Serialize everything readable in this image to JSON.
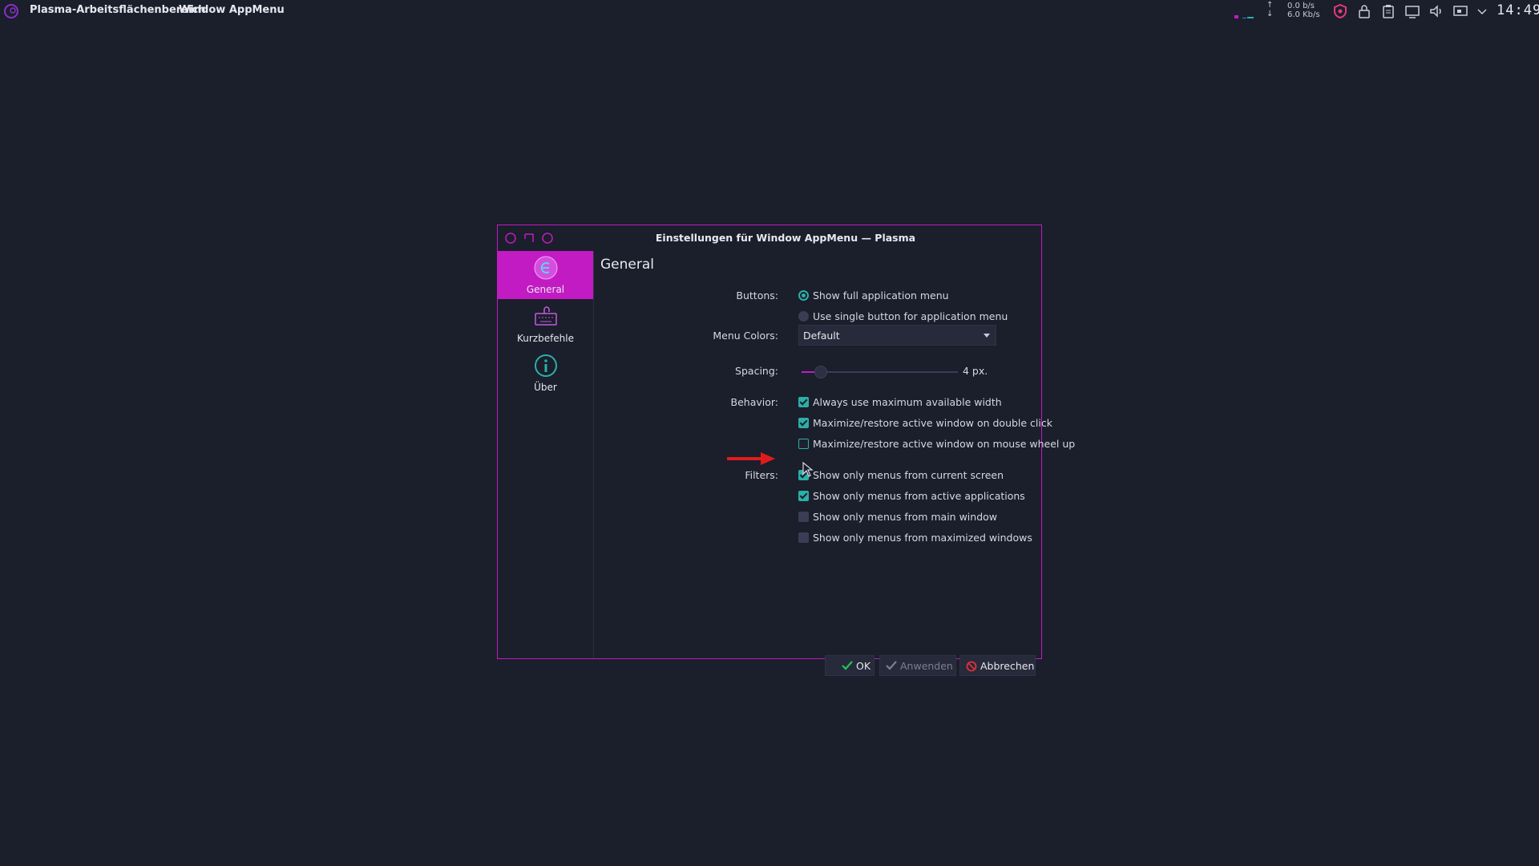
{
  "panel": {
    "activity_label": "Plasma-Arbeitsflächenbereich",
    "appmenu_label": "Window AppMenu",
    "net_up_speed": "0.0 b/s",
    "net_down_speed": "6.0 Kb/s",
    "net_up_arrow": "↑",
    "net_down_arrow": "↓",
    "clock": "14:49",
    "tray_icons": [
      "shield-icon",
      "lock-icon",
      "clipboard-icon",
      "display-icon",
      "volume-icon",
      "network-icon",
      "chevron-down-icon"
    ]
  },
  "dialog": {
    "title": "Einstellungen für Window AppMenu — Plasma",
    "sidebar": [
      {
        "label": "General",
        "icon": "appmenu-icon",
        "active": true
      },
      {
        "label": "Kurzbefehle",
        "icon": "keyboard-icon",
        "active": false
      },
      {
        "label": "Über",
        "icon": "info-icon",
        "active": false
      }
    ],
    "heading": "General",
    "buttons_label": "Buttons:",
    "buttons_options": [
      {
        "label": "Show full application menu",
        "selected": true
      },
      {
        "label": "Use single button for application menu",
        "selected": false
      }
    ],
    "menu_colors_label": "Menu Colors:",
    "menu_colors_value": "Default",
    "spacing_label": "Spacing:",
    "spacing_value": "4 px.",
    "spacing_fraction": 0.1,
    "behavior_label": "Behavior:",
    "behavior_options": [
      {
        "label": "Always use maximum available width",
        "checked": true
      },
      {
        "label": "Maximize/restore active window on double click",
        "checked": true
      },
      {
        "label": "Maximize/restore active window on mouse wheel up",
        "checked": false
      }
    ],
    "filters_label": "Filters:",
    "filters_options": [
      {
        "label": "Show only menus from current screen",
        "checked": true
      },
      {
        "label": "Show only menus from active applications",
        "checked": true
      },
      {
        "label": "Show only menus from main window",
        "checked": false
      },
      {
        "label": "Show only menus from maximized windows",
        "checked": false
      }
    ],
    "ok_label": "OK",
    "apply_label": "Anwenden",
    "cancel_label": "Abbrechen"
  },
  "colors": {
    "accent": "#c21bc3",
    "check": "#2ab0a8",
    "background": "#1b1e2b",
    "annotation_arrow": "#e01b1b"
  }
}
